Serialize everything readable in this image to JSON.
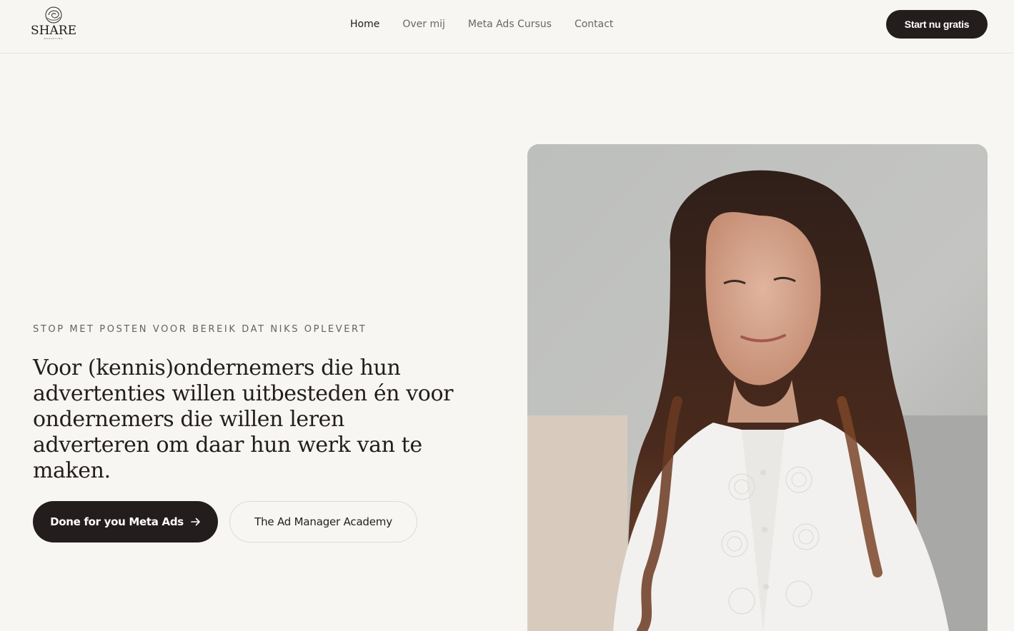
{
  "brand": {
    "logo_text": "SHARE",
    "logo_subtext": "MARKETING"
  },
  "nav": {
    "items": [
      {
        "label": "Home",
        "active": true
      },
      {
        "label": "Over mij",
        "active": false
      },
      {
        "label": "Meta Ads Cursus",
        "active": false
      },
      {
        "label": "Contact",
        "active": false
      }
    ]
  },
  "header_cta": {
    "label": "Start nu gratis"
  },
  "hero": {
    "eyebrow": "STOP MET POSTEN VOOR BEREIK DAT NIKS OPLEVERT",
    "headline": "Voor (kennis)ondernemers die hun advertenties willen uitbesteden én voor ondernemers die willen leren adverteren om daar hun werk van te maken.",
    "primary_button": {
      "label": "Done for you Meta Ads",
      "icon": "arrow-right-icon"
    },
    "secondary_button": {
      "label": "The Ad Manager Academy"
    }
  },
  "colors": {
    "background": "#f7f6f2",
    "dark": "#231e1d",
    "muted_text": "#6b6763"
  }
}
